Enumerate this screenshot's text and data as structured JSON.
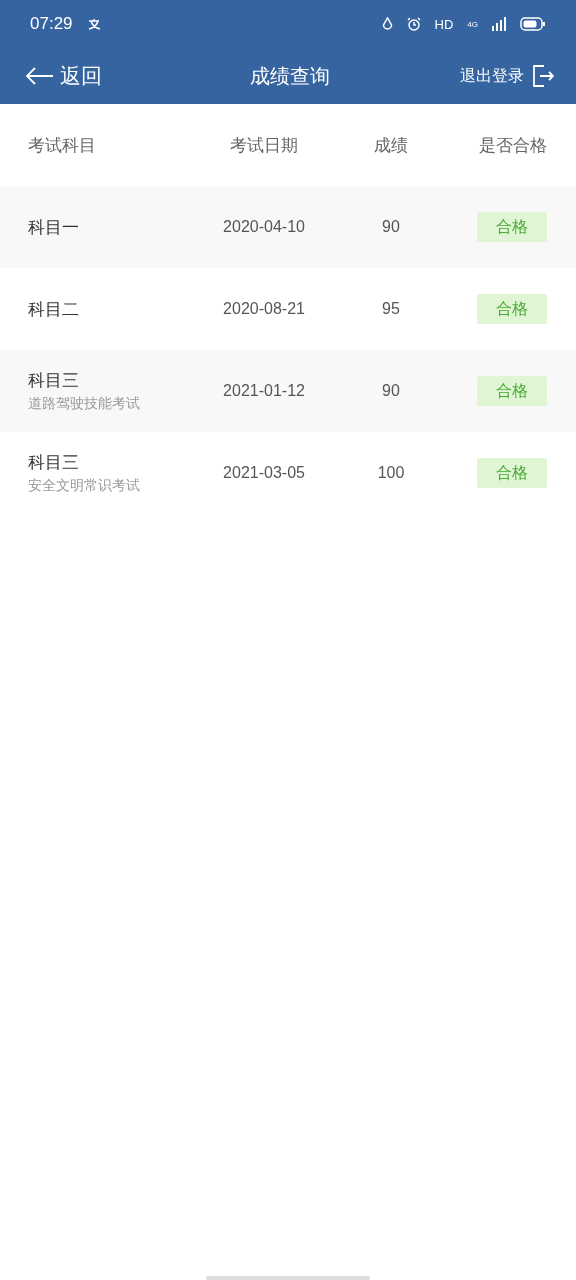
{
  "status_bar": {
    "time": "07:29",
    "network": "HD",
    "signal_type": "4G"
  },
  "nav": {
    "back": "返回",
    "title": "成绩查询",
    "logout": "退出登录"
  },
  "table": {
    "columns": [
      "考试科目",
      "考试日期",
      "成绩",
      "是否合格"
    ],
    "rows": [
      {
        "subject": "科目一",
        "date": "2020-04-10",
        "score": "90",
        "result": "合格",
        "passed": true
      },
      {
        "subject": "科目二",
        "date": "2020-08-21",
        "score": "95",
        "result": "合格",
        "passed": true
      },
      {
        "subject": "科目三",
        "note": "道路驾驶技能考试",
        "date": "2021-01-12",
        "score": "90",
        "result": "合格",
        "passed": true
      },
      {
        "subject": "科目三",
        "note": "安全文明常识考试",
        "date": "2021-03-05",
        "score": "100",
        "result": "合格",
        "passed": true
      }
    ]
  }
}
